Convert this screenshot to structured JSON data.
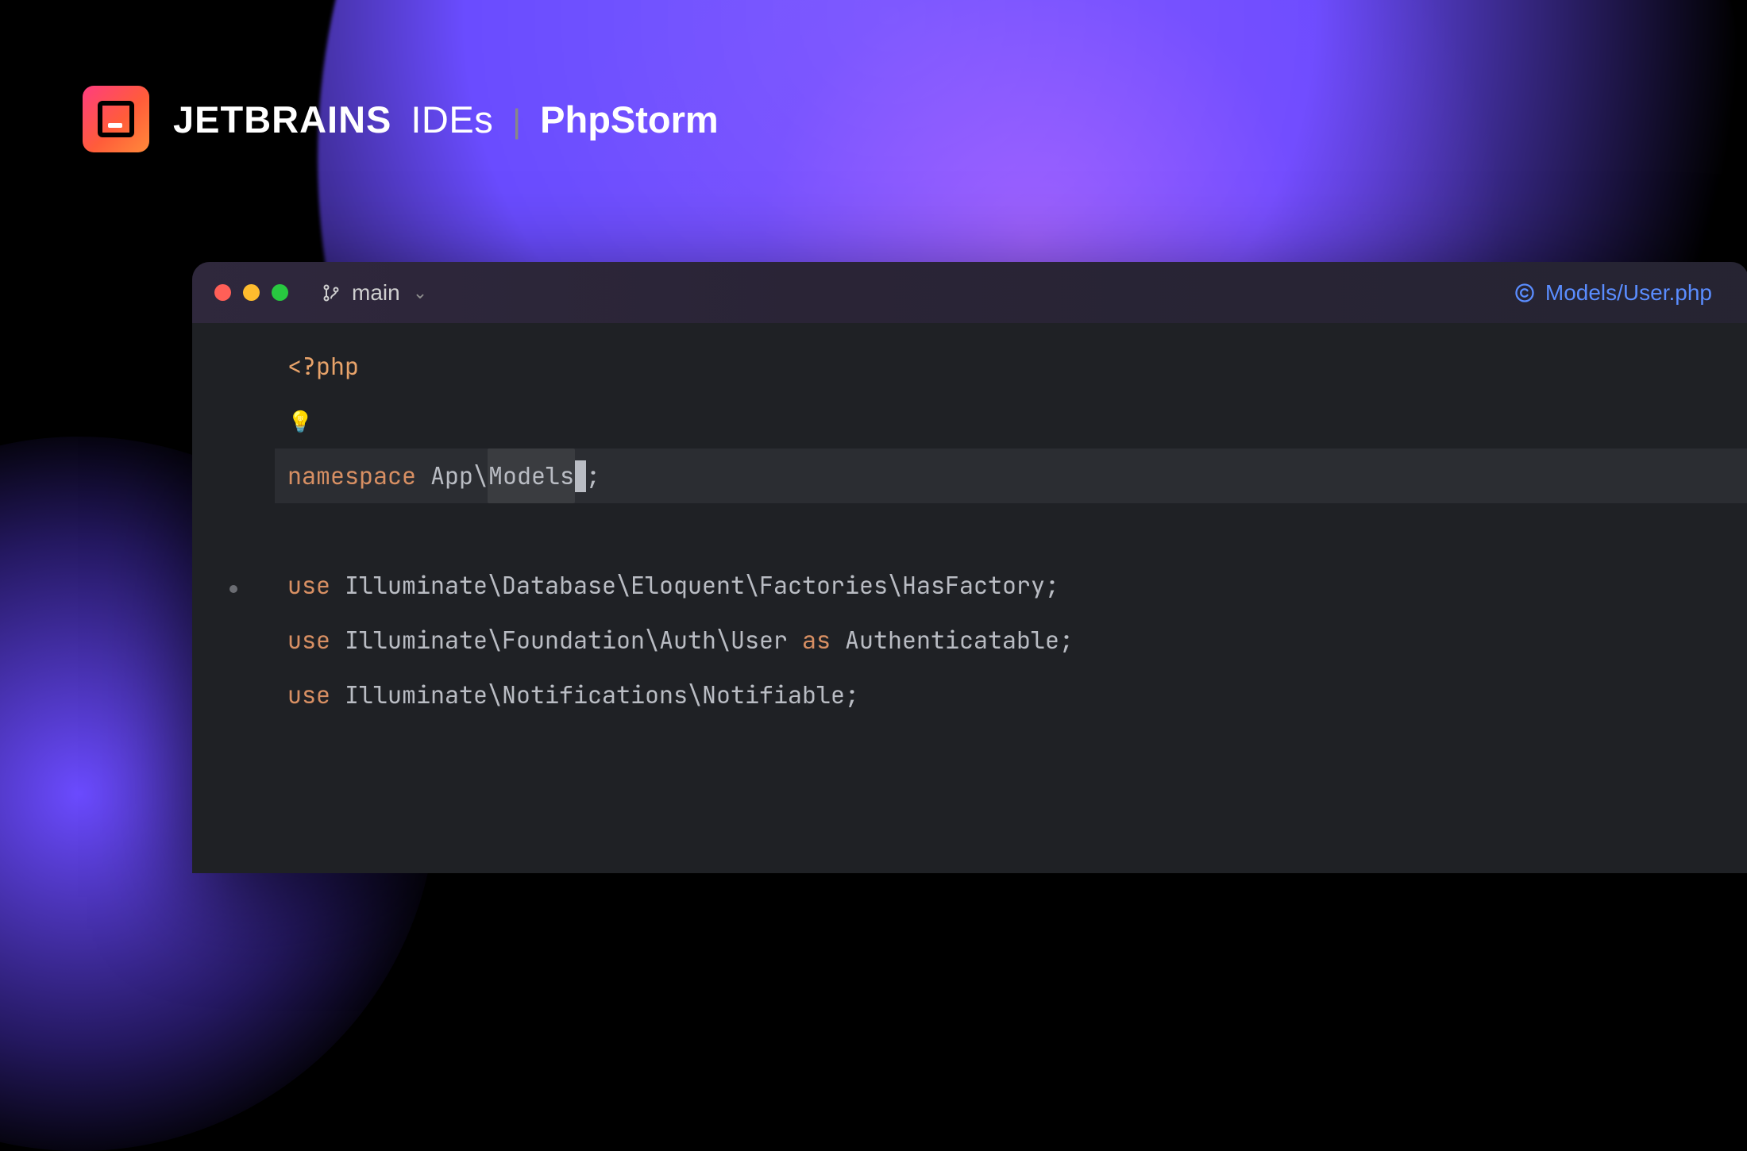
{
  "brand": {
    "company": "JETBRAINS",
    "suite": "IDEs",
    "product": "PhpStorm"
  },
  "titlebar": {
    "branch": "main",
    "filepath": "Models/User.php"
  },
  "code": {
    "open_tag": "<?php",
    "l3": {
      "kw": "namespace",
      "ns_root": "App",
      "ns_sel": "Models",
      "semi": ";"
    },
    "l5": {
      "kw": "use",
      "path": "Illuminate\\Database\\Eloquent\\Factories\\HasFactory;"
    },
    "l6": {
      "kw": "use",
      "path_a": "Illuminate\\Foundation\\Auth\\User",
      "as": "as",
      "path_b": "Authenticatable;"
    },
    "l7": {
      "kw": "use",
      "path": "Illuminate\\Notifications\\Notifiable;"
    }
  },
  "colors": {
    "accent_blue": "#5a8dff",
    "keyword": "#d78f63",
    "traffic_red": "#ff5f57",
    "traffic_yellow": "#febc2e",
    "traffic_green": "#28c840"
  }
}
